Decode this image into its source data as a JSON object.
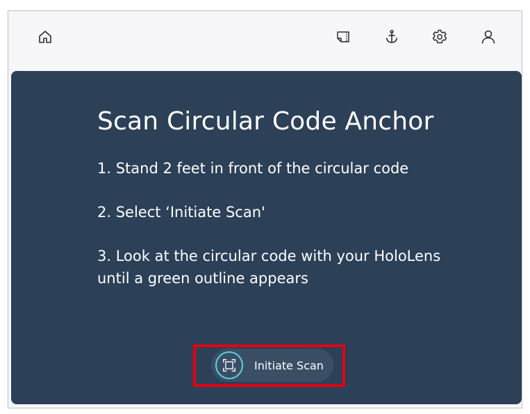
{
  "toolbar": {
    "icons": [
      "home-icon",
      "media-icon",
      "anchor-icon",
      "gear-icon",
      "user-icon"
    ]
  },
  "main": {
    "title": "Scan Circular Code Anchor",
    "steps": [
      "1. Stand 2 feet in front of the circular code",
      "2. Select ‘Initiate Scan'",
      "3. Look at the circular code with your HoloLens until a green outline appears"
    ],
    "scan_button": {
      "label": "Initiate Scan",
      "icon": "scan-frame-icon"
    }
  },
  "colors": {
    "panel_background": "#2c4058",
    "button_background": "#3a4f66",
    "icon_ring": "#5fd1e0",
    "highlight": "#e3000f"
  }
}
